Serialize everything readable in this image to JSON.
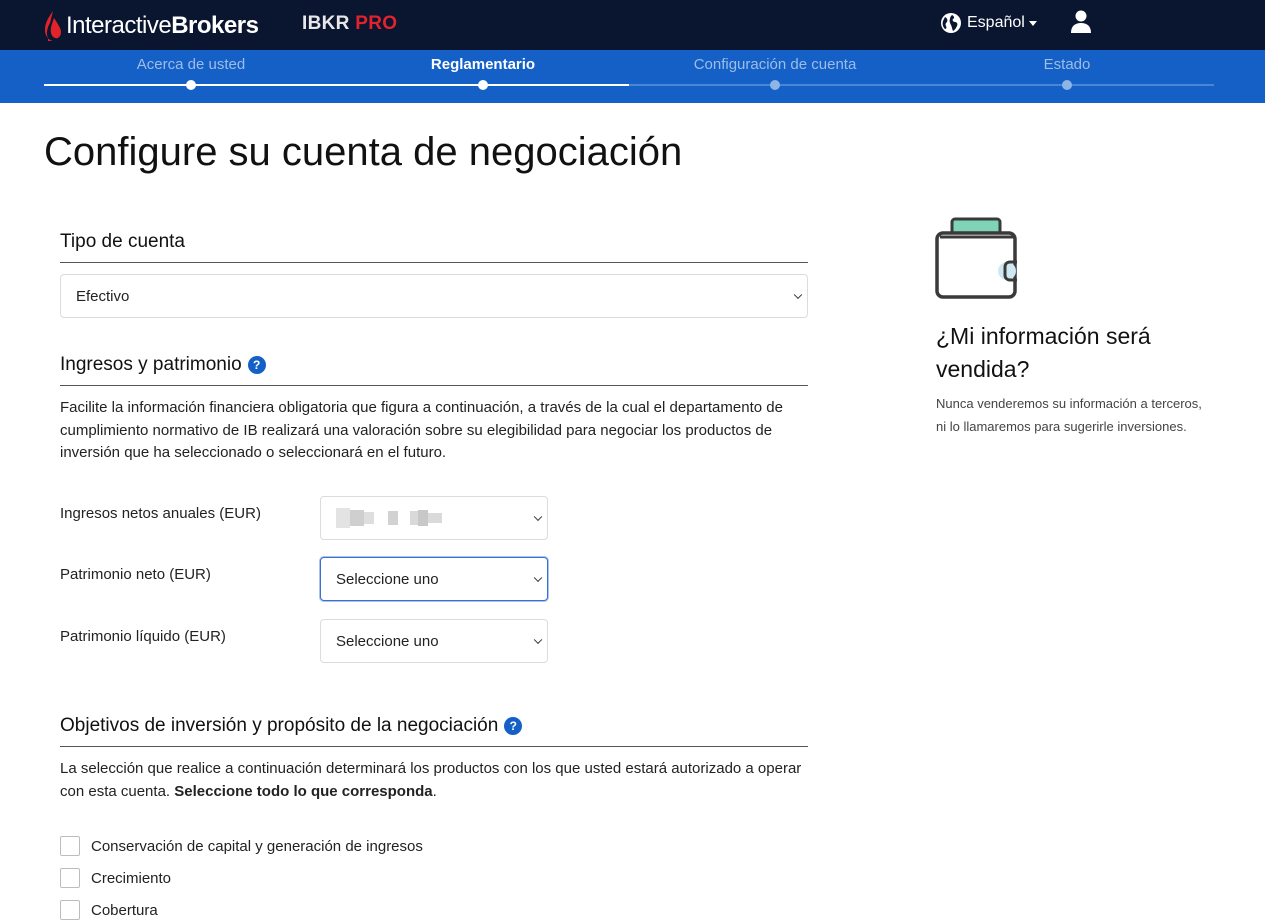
{
  "header": {
    "brand_regular": "Interactive",
    "brand_bold": "Brokers",
    "product": "IBKR",
    "product_suffix": "PRO",
    "language": "Español"
  },
  "steps": [
    {
      "label": "Acerca de usted",
      "state": "done"
    },
    {
      "label": "Reglamentario",
      "state": "active"
    },
    {
      "label": "Configuración de cuenta",
      "state": "pending"
    },
    {
      "label": "Estado",
      "state": "pending"
    }
  ],
  "page_title": "Configure su cuenta de negociación",
  "account_type": {
    "heading": "Tipo de cuenta",
    "selected": "Efectivo"
  },
  "income": {
    "heading": "Ingresos y patrimonio",
    "description": "Facilite la información financiera obligatoria que figura a continuación, a través de la cual el departamento de cumplimiento normativo de IB realizará una valoración sobre su elegibilidad para negociar los productos de inversión que ha seleccionado o seleccionará en el futuro.",
    "fields": [
      {
        "label": "Ingresos netos anuales (EUR)",
        "value": ""
      },
      {
        "label": "Patrimonio neto (EUR)",
        "value": "Seleccione uno"
      },
      {
        "label": "Patrimonio líquido (EUR)",
        "value": "Seleccione uno"
      }
    ]
  },
  "objectives": {
    "heading": "Objetivos de inversión y propósito de la negociación",
    "description": "La selección que realice a continuación determinará los productos con los que usted estará autorizado a operar con esta cuenta.",
    "description_bold": "Seleccione todo lo que corresponda",
    "description_end": ".",
    "options": [
      {
        "label": "Conservación de capital y generación de ingresos",
        "checked": false
      },
      {
        "label": "Crecimiento",
        "checked": false
      },
      {
        "label": "Cobertura",
        "checked": false
      }
    ]
  },
  "aside": {
    "icon": "wallet-icon",
    "title": "¿Mi información será vendida?",
    "text": "Nunca venderemos su información a terceros, ni lo llamaremos para sugerirle inversiones."
  },
  "colors": {
    "header_bg": "#0a1530",
    "progress_bg": "#1460c7",
    "brand_red": "#e2232b",
    "help_blue": "#1460c7"
  }
}
